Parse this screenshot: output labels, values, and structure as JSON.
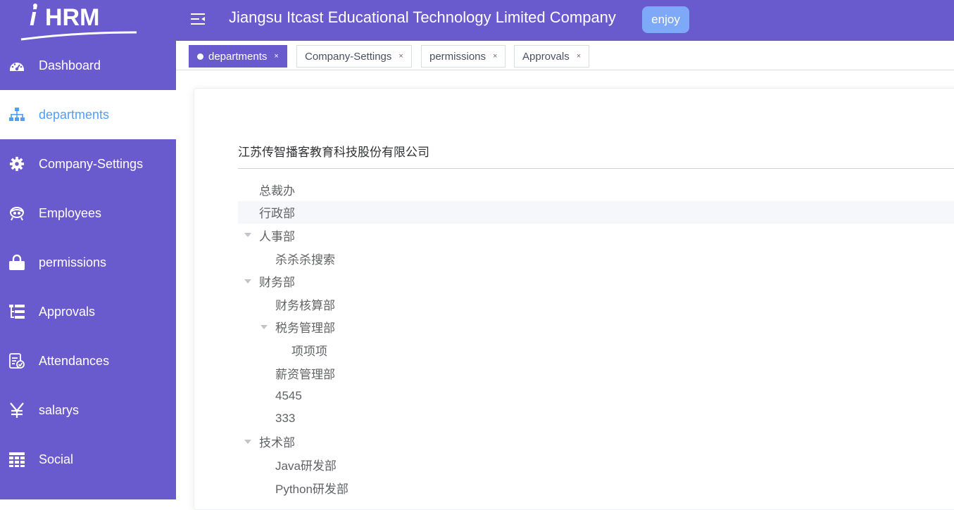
{
  "app": {
    "logo_text": "iHRM",
    "company_title": "Jiangsu Itcast Educational Technology Limited Company",
    "user_button": "enjoy",
    "theme_color": "#695bcd",
    "active_color": "#4f9ef8"
  },
  "sidebar": {
    "items": [
      {
        "label": "Dashboard",
        "icon": "dashboard-icon"
      },
      {
        "label": "departments",
        "icon": "org-tree-icon"
      },
      {
        "label": "Company-Settings",
        "icon": "gear-icon"
      },
      {
        "label": "Employees",
        "icon": "user-icon"
      },
      {
        "label": "permissions",
        "icon": "lock-icon"
      },
      {
        "label": "Approvals",
        "icon": "tree-table-icon"
      },
      {
        "label": "Attendances",
        "icon": "clipboard-check-icon"
      },
      {
        "label": "salarys",
        "icon": "yen-icon"
      },
      {
        "label": "Social",
        "icon": "grid-table-icon"
      }
    ],
    "active": "departments"
  },
  "tags": [
    {
      "label": "departments",
      "active": true
    },
    {
      "label": "Company-Settings",
      "active": false
    },
    {
      "label": "permissions",
      "active": false
    },
    {
      "label": "Approvals",
      "active": false
    }
  ],
  "tag_close": "×",
  "tree": {
    "header": "江苏传智播客教育科技股份有限公司",
    "nodes": [
      {
        "label": "总裁办",
        "level": 0,
        "expandable": false
      },
      {
        "label": "行政部",
        "level": 0,
        "expandable": false
      },
      {
        "label": "人事部",
        "level": 0,
        "expandable": true
      },
      {
        "label": "杀杀杀搜索",
        "level": 1,
        "expandable": false
      },
      {
        "label": "财务部",
        "level": 0,
        "expandable": true
      },
      {
        "label": "财务核算部",
        "level": 1,
        "expandable": false
      },
      {
        "label": "税务管理部",
        "level": 1,
        "expandable": true
      },
      {
        "label": "项项项",
        "level": 2,
        "expandable": false
      },
      {
        "label": "薪资管理部",
        "level": 1,
        "expandable": false
      },
      {
        "label": "4545",
        "level": 1,
        "expandable": false
      },
      {
        "label": "333",
        "level": 1,
        "expandable": false
      },
      {
        "label": "技术部",
        "level": 0,
        "expandable": true
      },
      {
        "label": "Java研发部",
        "level": 1,
        "expandable": false
      },
      {
        "label": "Python研发部",
        "level": 1,
        "expandable": false
      }
    ]
  }
}
